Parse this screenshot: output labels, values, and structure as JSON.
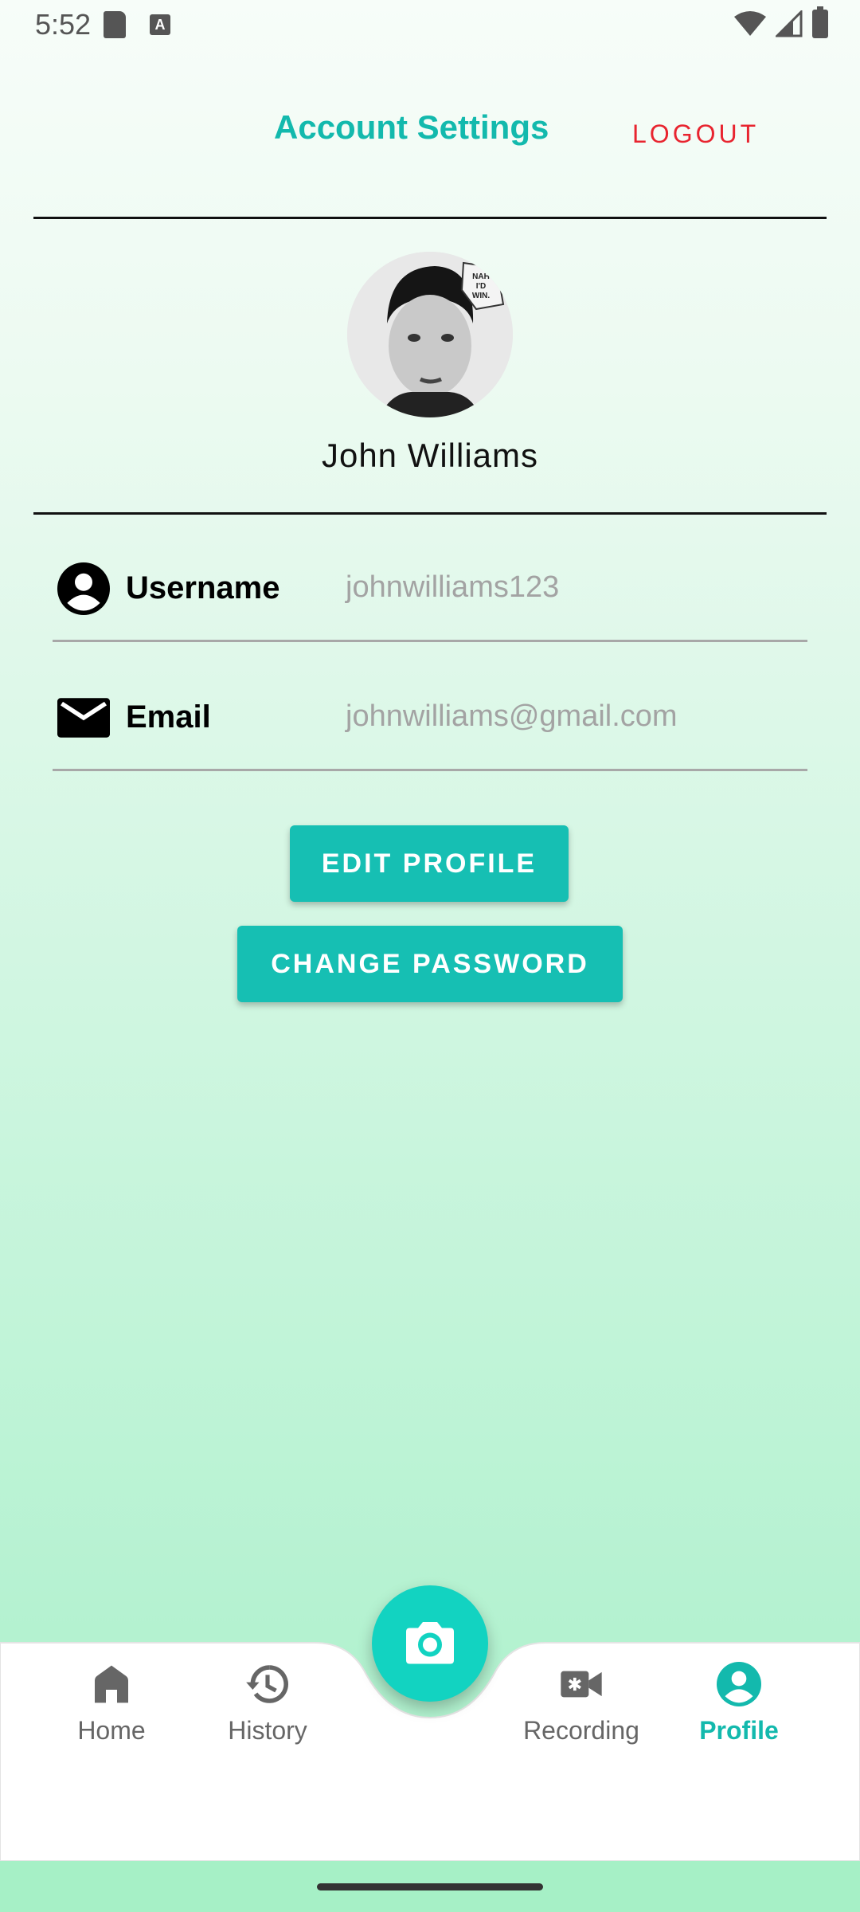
{
  "status_bar": {
    "time": "5:52",
    "a_badge": "A"
  },
  "header": {
    "title": "Account Settings",
    "logout_label": "LOGOUT"
  },
  "profile": {
    "name": "John Williams",
    "avatar_caption": "NAH I'D WIN."
  },
  "fields": [
    {
      "label": "Username",
      "value": "johnwilliams123",
      "icon": "account-circle-icon"
    },
    {
      "label": "Email",
      "value": "johnwilliams@gmail.com",
      "icon": "mail-icon"
    }
  ],
  "buttons": {
    "edit_profile": "EDIT PROFILE",
    "change_password": "CHANGE PASSWORD"
  },
  "nav": {
    "items": [
      {
        "label": "Home",
        "icon": "home-icon",
        "active": false
      },
      {
        "label": "History",
        "icon": "history-icon",
        "active": false
      },
      {
        "label": "Recording",
        "icon": "video-camera-icon",
        "active": false
      },
      {
        "label": "Profile",
        "icon": "account-circle-icon",
        "active": true
      }
    ],
    "fab_icon": "camera-icon"
  },
  "colors": {
    "accent": "#13b9ad",
    "logout": "#e8242f",
    "fab": "#12d3c1"
  }
}
